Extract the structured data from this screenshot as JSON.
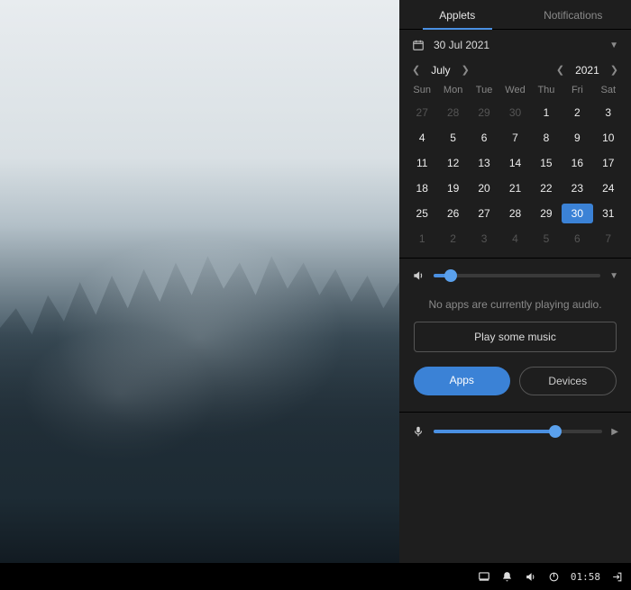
{
  "tabs": {
    "applets": "Applets",
    "notifications": "Notifications",
    "active": "applets"
  },
  "date": {
    "display": "30 Jul 2021"
  },
  "calendar": {
    "month_label": "July",
    "year_label": "2021",
    "dow": [
      "Sun",
      "Mon",
      "Tue",
      "Wed",
      "Thu",
      "Fri",
      "Sat"
    ],
    "weeks": [
      [
        {
          "d": "27",
          "m": true
        },
        {
          "d": "28",
          "m": true
        },
        {
          "d": "29",
          "m": true
        },
        {
          "d": "30",
          "m": true
        },
        {
          "d": "1"
        },
        {
          "d": "2"
        },
        {
          "d": "3"
        }
      ],
      [
        {
          "d": "4"
        },
        {
          "d": "5"
        },
        {
          "d": "6"
        },
        {
          "d": "7"
        },
        {
          "d": "8"
        },
        {
          "d": "9"
        },
        {
          "d": "10"
        }
      ],
      [
        {
          "d": "11"
        },
        {
          "d": "12"
        },
        {
          "d": "13"
        },
        {
          "d": "14"
        },
        {
          "d": "15"
        },
        {
          "d": "16"
        },
        {
          "d": "17"
        }
      ],
      [
        {
          "d": "18"
        },
        {
          "d": "19"
        },
        {
          "d": "20"
        },
        {
          "d": "21"
        },
        {
          "d": "22"
        },
        {
          "d": "23"
        },
        {
          "d": "24"
        }
      ],
      [
        {
          "d": "25"
        },
        {
          "d": "26"
        },
        {
          "d": "27"
        },
        {
          "d": "28"
        },
        {
          "d": "29"
        },
        {
          "d": "30",
          "sel": true
        },
        {
          "d": "31"
        }
      ],
      [
        {
          "d": "1",
          "m": true
        },
        {
          "d": "2",
          "m": true
        },
        {
          "d": "3",
          "m": true
        },
        {
          "d": "4",
          "m": true
        },
        {
          "d": "5",
          "m": true
        },
        {
          "d": "6",
          "m": true
        },
        {
          "d": "7",
          "m": true
        }
      ]
    ]
  },
  "audio": {
    "volume_percent": 10,
    "no_apps_text": "No apps are currently playing audio.",
    "play_button": "Play some music",
    "apps_label": "Apps",
    "devices_label": "Devices",
    "mic_percent": 72
  },
  "taskbar": {
    "clock": "01:58"
  },
  "colors": {
    "accent": "#3b82d6"
  }
}
